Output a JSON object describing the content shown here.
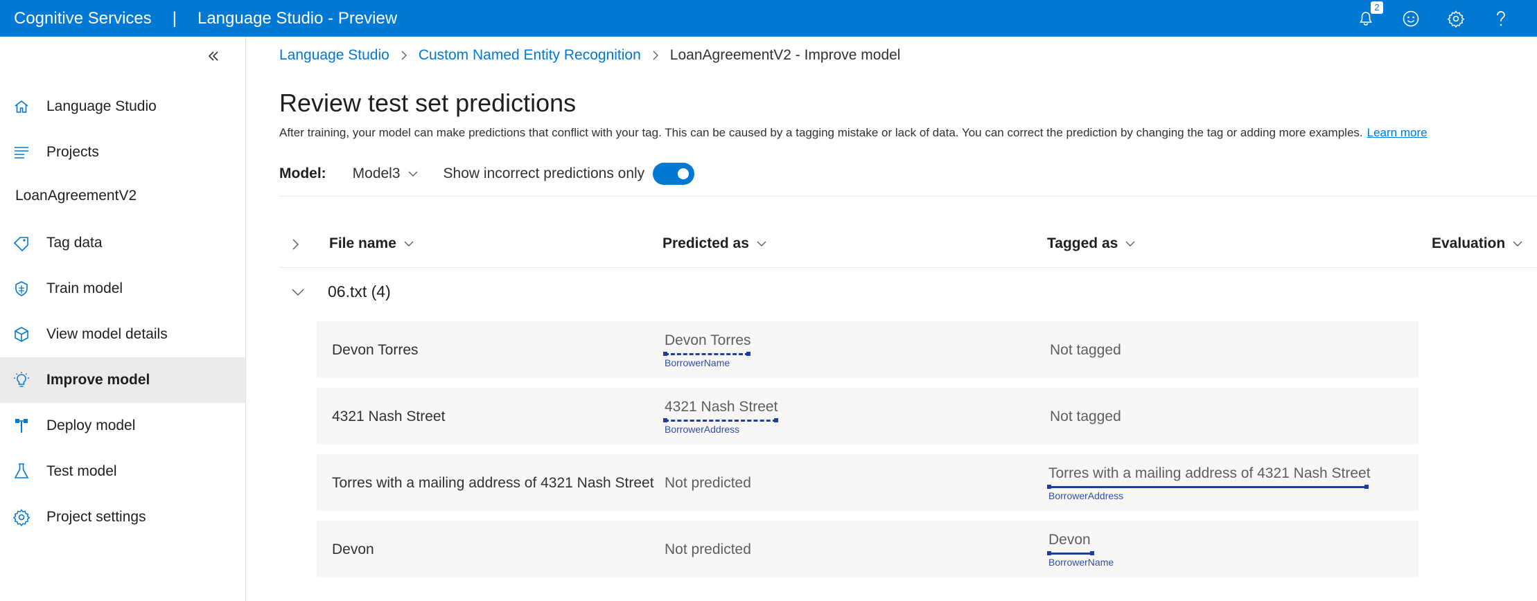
{
  "topbar": {
    "brand": "Cognitive Services",
    "separator": "|",
    "product": "Language Studio - Preview",
    "notification_count": "2",
    "icons": [
      "bell-icon",
      "feedback-smiley-icon",
      "gear-icon",
      "help-icon"
    ]
  },
  "sidebar": {
    "items": [
      {
        "label": "Language Studio",
        "icon": "home-icon"
      },
      {
        "label": "Projects",
        "icon": "list-icon"
      },
      {
        "label": "Tag data",
        "icon": "tag-icon"
      },
      {
        "label": "Train model",
        "icon": "train-icon"
      },
      {
        "label": "View model details",
        "icon": "cube-icon"
      },
      {
        "label": "Improve model",
        "icon": "lightbulb-icon"
      },
      {
        "label": "Deploy model",
        "icon": "deploy-icon"
      },
      {
        "label": "Test model",
        "icon": "flask-icon"
      },
      {
        "label": "Project settings",
        "icon": "gear-icon"
      }
    ],
    "project_name": "LoanAgreementV2"
  },
  "breadcrumb": {
    "items": [
      "Language Studio",
      "Custom Named Entity Recognition"
    ],
    "current": "LoanAgreementV2 - Improve model"
  },
  "page": {
    "title": "Review test set predictions",
    "description": "After training, your model can make predictions that conflict with your tag. This can be caused by a tagging mistake or lack of data. You can correct the prediction by changing the tag or adding more examples.",
    "learn_more": "Learn more",
    "model_label": "Model:",
    "model_value": "Model3",
    "toggle_label": "Show incorrect predictions only",
    "toggle_on": true
  },
  "table": {
    "columns": [
      "File name",
      "Predicted as",
      "Tagged as",
      "Evaluation"
    ],
    "group_label": "06.txt (4)",
    "rows": [
      {
        "text": "Devon Torres",
        "predicted": {
          "text": "Devon Torres",
          "tag": "BorrowerName"
        },
        "tagged": "Not tagged"
      },
      {
        "text": "4321 Nash Street",
        "predicted": {
          "text": "4321 Nash Street",
          "tag": "BorrowerAddress"
        },
        "tagged": "Not tagged"
      },
      {
        "text": "Torres with a mailing address of 4321 Nash Street",
        "predicted": "Not predicted",
        "tagged": {
          "text": "Torres with a mailing address of 4321 Nash Street",
          "tag": "BorrowerAddress"
        }
      },
      {
        "text": "Devon",
        "predicted": "Not predicted",
        "tagged": {
          "text": "Devon",
          "tag": "BorrowerName"
        }
      }
    ]
  }
}
